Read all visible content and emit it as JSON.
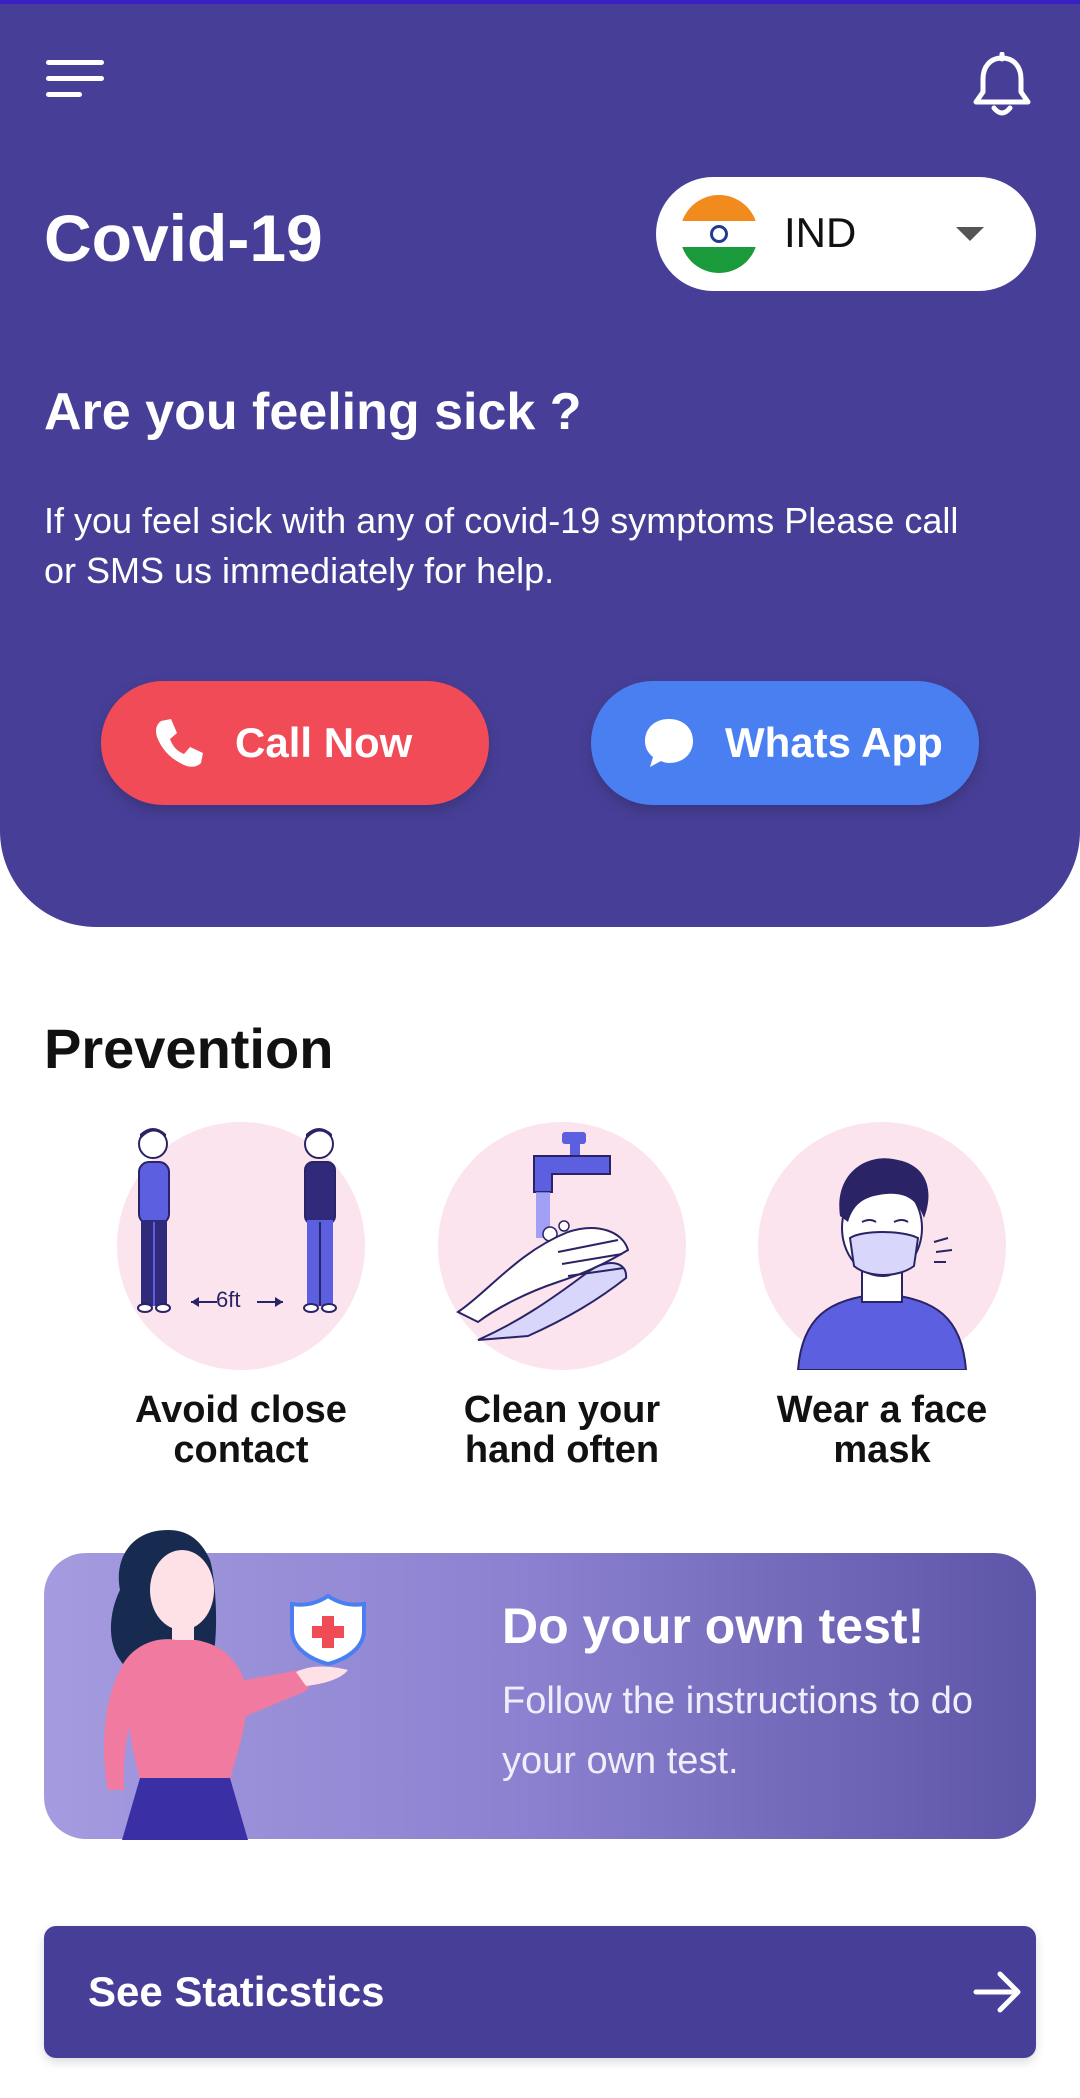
{
  "app": {
    "title": "Covid-19"
  },
  "header": {
    "menu_icon": "hamburger-menu-icon",
    "notification_icon": "bell-icon"
  },
  "country_selector": {
    "code": "IND",
    "flag_icon": "india-flag-icon",
    "dropdown_icon": "caret-down-icon"
  },
  "hero": {
    "title": "Are you feeling sick ?",
    "text": "If you feel sick with any of covid-19 symptoms Please call or SMS us immediately for help.",
    "call_label": "Call Now",
    "call_icon": "phone-icon",
    "whatsapp_label": "Whats App",
    "whatsapp_icon": "chat-bubble-icon"
  },
  "prevention": {
    "title": "Prevention",
    "items": [
      {
        "label": "Avoid close contact",
        "distance": "6ft",
        "icon": "social-distance-illustration"
      },
      {
        "label": "Clean your hand often",
        "icon": "handwashing-illustration"
      },
      {
        "label": "Wear a face mask",
        "icon": "face-mask-illustration"
      }
    ]
  },
  "test_card": {
    "title": "Do your own test!",
    "subtitle": "Follow the instructions to do your own test."
  },
  "statistics": {
    "label": "See Staticstics",
    "icon": "arrow-right-icon"
  },
  "colors": {
    "primary": "#473f97",
    "call": "#f04b57",
    "whatsapp": "#4a7ff2",
    "circle": "#fbe4ee"
  }
}
